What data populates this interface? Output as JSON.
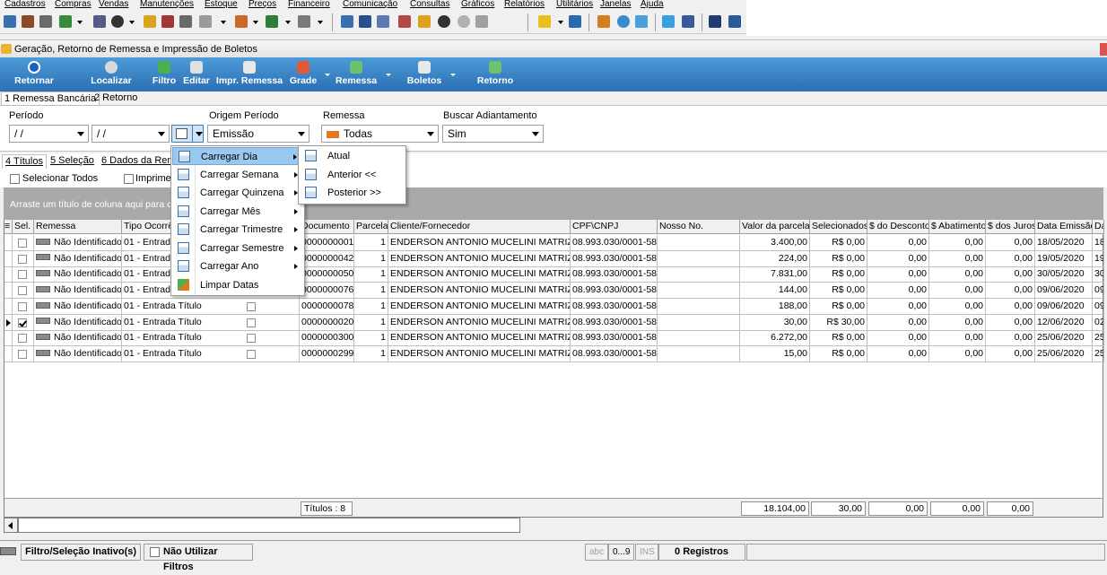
{
  "menubar": [
    "Cadastros",
    "Compras",
    "Vendas",
    "Manutenções",
    "Estoque",
    "Preços",
    "Financeiro",
    "Comunicação",
    "Consultas",
    "Gráficos",
    "Relatórios",
    "Utilitários",
    "Janelas",
    "Ajuda"
  ],
  "window": {
    "title": "Geração, Retorno de Remessa e Impressão de Boletos"
  },
  "toolbar": {
    "retornar": "Retornar",
    "localizar": "Localizar",
    "filtro": "Filtro",
    "editar": "Editar",
    "impr_remessa": "Impr. Remessa",
    "grade": "Grade",
    "remessa": "Remessa",
    "boletos": "Boletos",
    "retorno": "Retorno"
  },
  "tabs_top": [
    "1 Remessa Bancária",
    "2 Retorno"
  ],
  "filters": {
    "periodo_label": "Período",
    "date_from": " / /",
    "date_to": " / /",
    "origem_label": "Origem Período",
    "origem_value": "Emissão",
    "remessa_label": "Remessa",
    "remessa_value": "Todas",
    "adiantamento_label": "Buscar Adiantamento",
    "adiantamento_value": "Sim"
  },
  "tabs_sub": [
    "4 Títulos",
    "5 Seleção",
    "6 Dados da Reme"
  ],
  "options": {
    "selecionar_todos": "Selecionar Todos",
    "imprime": "Imprime"
  },
  "group_hint": "Arraste um título de coluna aqui para cria",
  "columns": [
    "Sel.",
    "Remessa",
    "Tipo Ocorrê",
    "Documento",
    "Parcela",
    "Cliente/Fornecedor",
    "CPF\\CNPJ",
    "Nosso No.",
    "Valor da parcela",
    "Selecionados",
    "$ do Desconto",
    "$ Abatimento",
    "$ dos Juros",
    "Data Emissão",
    "Da"
  ],
  "rows": [
    {
      "sel": false,
      "remessa": "Não Identificado",
      "tipo": "01 - Entrada",
      "doc": "0000000001",
      "parcela": "1",
      "cliente": "ENDERSON ANTONIO MUCELINI MATRIZ",
      "cnpj": "08.993.030/0001-58",
      "nosso": "",
      "valor": "3.400,00",
      "selecionados": "R$ 0,00",
      "desconto": "0,00",
      "abatimento": "0,00",
      "juros": "0,00",
      "emissao": "18/05/2020",
      "da": "18"
    },
    {
      "sel": false,
      "remessa": "Não Identificado",
      "tipo": "01 - Entrada",
      "doc": "0000000042",
      "parcela": "1",
      "cliente": "ENDERSON ANTONIO MUCELINI MATRIZ",
      "cnpj": "08.993.030/0001-58",
      "nosso": "",
      "valor": "224,00",
      "selecionados": "R$ 0,00",
      "desconto": "0,00",
      "abatimento": "0,00",
      "juros": "0,00",
      "emissao": "19/05/2020",
      "da": "19"
    },
    {
      "sel": false,
      "remessa": "Não Identificado",
      "tipo": "01 - Entrada",
      "doc": "0000000050",
      "parcela": "1",
      "cliente": "ENDERSON ANTONIO MUCELINI MATRIZ",
      "cnpj": "08.993.030/0001-58",
      "nosso": "",
      "valor": "7.831,00",
      "selecionados": "R$ 0,00",
      "desconto": "0,00",
      "abatimento": "0,00",
      "juros": "0,00",
      "emissao": "30/05/2020",
      "da": "30"
    },
    {
      "sel": false,
      "remessa": "Não Identificado",
      "tipo": "01 - Entrada",
      "doc": "0000000076",
      "parcela": "1",
      "cliente": "ENDERSON ANTONIO MUCELINI MATRIZ",
      "cnpj": "08.993.030/0001-58",
      "nosso": "",
      "valor": "144,00",
      "selecionados": "R$ 0,00",
      "desconto": "0,00",
      "abatimento": "0,00",
      "juros": "0,00",
      "emissao": "09/06/2020",
      "da": "09"
    },
    {
      "sel": false,
      "remessa": "Não Identificado",
      "tipo": "01 - Entrada Título",
      "doc": "0000000078",
      "parcela": "1",
      "cliente": "ENDERSON ANTONIO MUCELINI MATRIZ",
      "cnpj": "08.993.030/0001-58",
      "nosso": "",
      "valor": "188,00",
      "selecionados": "R$ 0,00",
      "desconto": "0,00",
      "abatimento": "0,00",
      "juros": "0,00",
      "emissao": "09/06/2020",
      "da": "09"
    },
    {
      "sel": true,
      "remessa": "Não Identificado",
      "tipo": "01 - Entrada Título",
      "doc": "0000000020",
      "parcela": "1",
      "cliente": "ENDERSON ANTONIO MUCELINI MATRIZ",
      "cnpj": "08.993.030/0001-58",
      "nosso": "",
      "valor": "30,00",
      "selecionados": "R$ 30,00",
      "desconto": "0,00",
      "abatimento": "0,00",
      "juros": "0,00",
      "emissao": "12/06/2020",
      "da": "02"
    },
    {
      "sel": false,
      "remessa": "Não Identificado",
      "tipo": "01 - Entrada Título",
      "doc": "0000000300",
      "parcela": "1",
      "cliente": "ENDERSON ANTONIO MUCELINI MATRIZ",
      "cnpj": "08.993.030/0001-58",
      "nosso": "",
      "valor": "6.272,00",
      "selecionados": "R$ 0,00",
      "desconto": "0,00",
      "abatimento": "0,00",
      "juros": "0,00",
      "emissao": "25/06/2020",
      "da": "25"
    },
    {
      "sel": false,
      "remessa": "Não Identificado",
      "tipo": "01 - Entrada Título",
      "doc": "0000000299",
      "parcela": "1",
      "cliente": "ENDERSON ANTONIO MUCELINI MATRIZ",
      "cnpj": "08.993.030/0001-58",
      "nosso": "",
      "valor": "15,00",
      "selecionados": "R$ 0,00",
      "desconto": "0,00",
      "abatimento": "0,00",
      "juros": "0,00",
      "emissao": "25/06/2020",
      "da": "25"
    }
  ],
  "footer": {
    "titulos": "Títulos : 8",
    "total_valor": "18.104,00",
    "total_sel": "30,00",
    "total_desc": "0,00",
    "total_abat": "0,00",
    "total_juros": "0,00"
  },
  "statusbar": {
    "filtro": "Filtro/Seleção Inativo(s)",
    "nao_filtros": "Não Utilizar Filtros",
    "abc": "abc",
    "nums": "0...9",
    "ins": "INS",
    "registros": "0 Registros"
  },
  "menu_periodo": [
    "Carregar Dia",
    "Carregar Semana",
    "Carregar Quinzena",
    "Carregar Mês",
    "Carregar Trimestre",
    "Carregar Semestre",
    "Carregar Ano",
    "Limpar Datas"
  ],
  "menu_dia": [
    "Atual",
    "Anterior <<",
    "Posterior >>"
  ],
  "colors": {
    "toolbar_blue": "#3f86c8",
    "menu_highlight": "#99c9ef"
  }
}
